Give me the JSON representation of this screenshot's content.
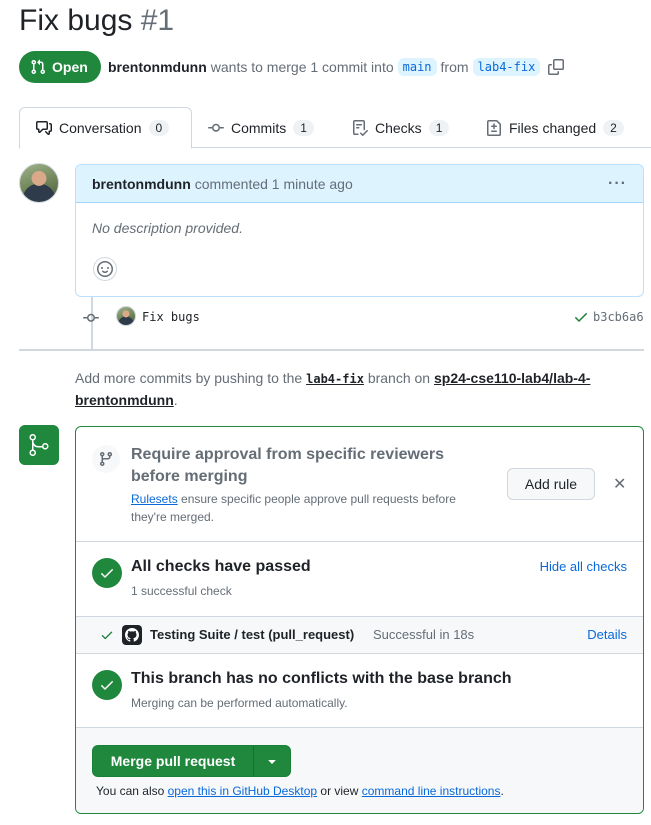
{
  "pr": {
    "title": "Fix bugs",
    "number": "#1",
    "state": "Open",
    "author": "brentonmdunn",
    "merge_text": "wants to merge 1 commit into",
    "base_branch": "main",
    "from_text": "from",
    "head_branch": "lab4-fix"
  },
  "tabs": [
    {
      "label": "Conversation",
      "count": "0"
    },
    {
      "label": "Commits",
      "count": "1"
    },
    {
      "label": "Checks",
      "count": "1"
    },
    {
      "label": "Files changed",
      "count": "2"
    }
  ],
  "comment": {
    "author": "brentonmdunn",
    "action": "commented 1 minute ago",
    "menu": "···",
    "body": "No description provided."
  },
  "commit": {
    "message": "Fix bugs",
    "sha": "b3cb6a6"
  },
  "push_note": {
    "prefix": "Add more commits by pushing to the",
    "branch": "lab4-fix",
    "middle": "branch on",
    "repo": "sp24-cse110-lab4/lab-4-brentonmdunn",
    "suffix": "."
  },
  "merge_box": {
    "ruleset": {
      "heading": "Require approval from specific reviewers before merging",
      "link": "Rulesets",
      "text": "ensure specific people approve pull requests before they're merged.",
      "add_rule": "Add rule",
      "close": "✕"
    },
    "checks": {
      "heading": "All checks have passed",
      "sub": "1 successful check",
      "toggle": "Hide all checks"
    },
    "check_item": {
      "name": "Testing Suite / test (pull_request)",
      "status": "Successful in 18s",
      "details": "Details"
    },
    "conflicts": {
      "heading": "This branch has no conflicts with the base branch",
      "sub": "Merging can be performed automatically."
    },
    "merge": {
      "button": "Merge pull request",
      "also_prefix": "You can also",
      "desktop_link": "open this in GitHub Desktop",
      "or_view": "or view",
      "cli_link": "command line instructions",
      "suffix": "."
    }
  },
  "colors": {
    "green": "#1f883d",
    "blue": "#0969da",
    "muted": "#656d76"
  }
}
